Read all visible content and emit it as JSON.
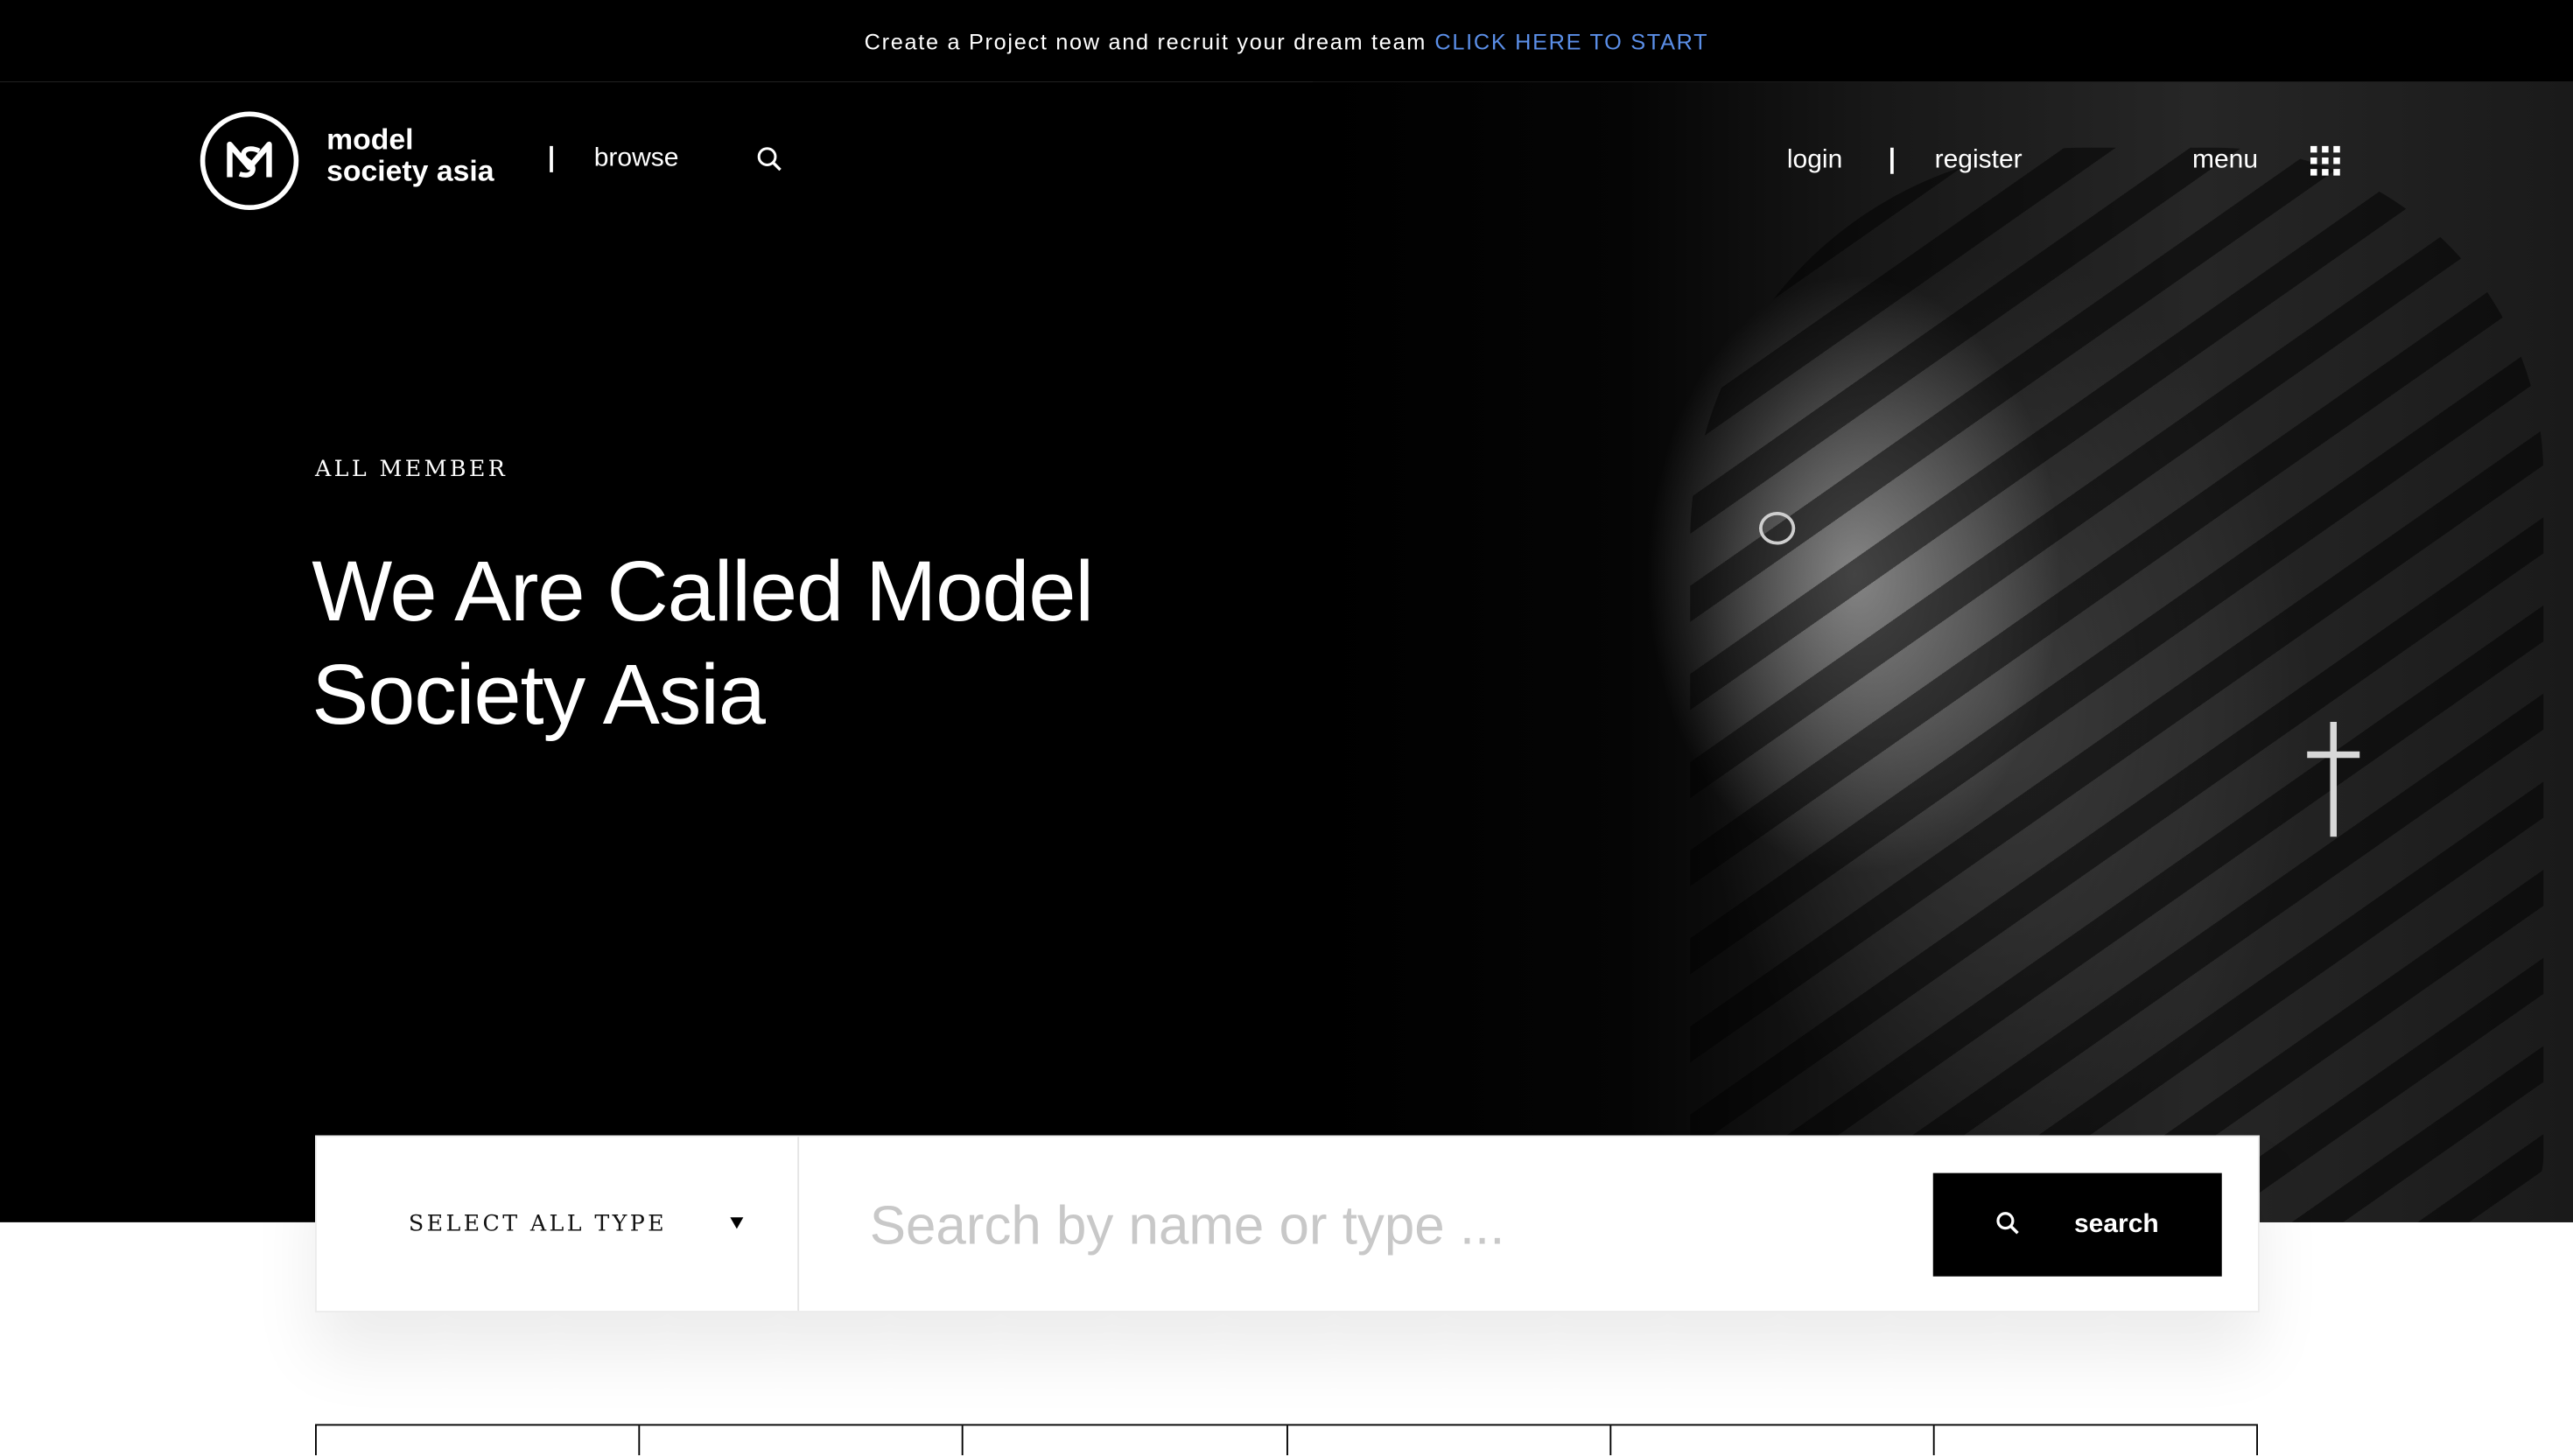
{
  "announcement": {
    "text": "Create a Project now and recruit your dream team",
    "cta": "CLICK HERE TO START",
    "cta_color": "#5b8fe8"
  },
  "header": {
    "brand_line1": "model",
    "brand_line2": "society asia",
    "browse": "browse",
    "login": "login",
    "register": "register",
    "menu": "menu"
  },
  "hero": {
    "eyebrow": "ALL MEMBER",
    "title_line1": "We Are Called Model",
    "title_line2": "Society Asia"
  },
  "search": {
    "type_select": "SELECT ALL TYPE",
    "placeholder": "Search by name or type ...",
    "button_label": "search"
  },
  "icons": {
    "logo": "ms-monogram-logo",
    "search": "search-icon",
    "menu": "grid-icon",
    "caret": "caret-down-icon"
  }
}
